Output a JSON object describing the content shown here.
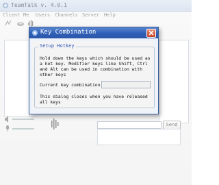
{
  "app": {
    "title": "TeamTalk v. 4.0.1",
    "menu": [
      "Client",
      "Me",
      "Users",
      "Channels",
      "Server",
      "Help"
    ]
  },
  "main": {
    "send_label": "Send"
  },
  "dialog": {
    "title": "Key Combination",
    "group_title": "Setup Hotkey",
    "instructions": "Hold down the keys which should be used as\na hot key. Modifier keys like Shift, Ctrl\nand Alt can be used in combination with\nother keys",
    "combination_label": "Current key combination",
    "combination_value": "",
    "note": "This dialog closes when you have released\nall keys"
  },
  "colors": {
    "title_bar": "#2f5fb6",
    "close_button": "#c8442a",
    "group_title": "#2d54b8"
  }
}
